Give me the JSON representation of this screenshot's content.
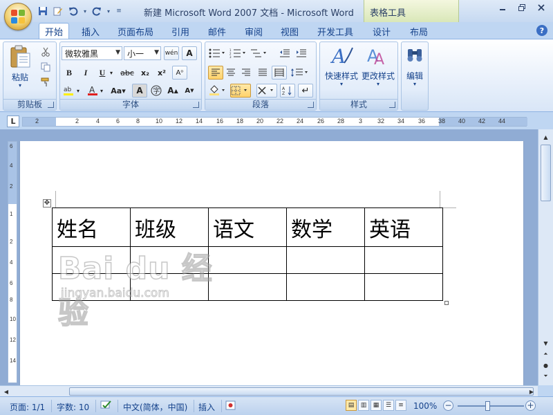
{
  "title": "新建 Microsoft Word 2007 文档 - Microsoft Word",
  "context_tab": "表格工具",
  "qat": {
    "save_icon": "save-icon",
    "undo_icon": "undo-icon",
    "redo_icon": "redo-icon"
  },
  "tabs": [
    "开始",
    "插入",
    "页面布局",
    "引用",
    "邮件",
    "审阅",
    "视图",
    "开发工具",
    "设计",
    "布局"
  ],
  "ribbon": {
    "clipboard": {
      "label": "剪贴板",
      "paste": "粘贴"
    },
    "font": {
      "label": "字体",
      "font_name": "微软雅黑",
      "font_size": "小一"
    },
    "paragraph": {
      "label": "段落"
    },
    "styles": {
      "label": "样式",
      "quick_styles": "快速样式",
      "change_styles": "更改样式"
    },
    "editing": {
      "label": "编辑"
    }
  },
  "ruler_numbers": [
    "2",
    "2",
    "4",
    "6",
    "8",
    "10",
    "12",
    "14",
    "16",
    "18",
    "20",
    "22",
    "24",
    "26",
    "28",
    "3",
    "32",
    "34",
    "36",
    "38",
    "40",
    "42",
    "44"
  ],
  "vruler_numbers": [
    "6",
    "4",
    "2",
    "1",
    "2",
    "4",
    "6",
    "8",
    "10",
    "12",
    "14"
  ],
  "table": {
    "headers": [
      "姓名",
      "班级",
      "语文",
      "数学",
      "英语"
    ],
    "rows": [
      [
        "",
        "",
        "",
        "",
        ""
      ],
      [
        "",
        "",
        "",
        "",
        ""
      ]
    ]
  },
  "watermark": {
    "brand": "Bai du 经验",
    "url": "jingyan.baidu.com"
  },
  "status": {
    "page": "页面: 1/1",
    "words": "字数: 10",
    "language": "中文(简体，中国)",
    "mode": "插入",
    "zoom": "100%"
  }
}
